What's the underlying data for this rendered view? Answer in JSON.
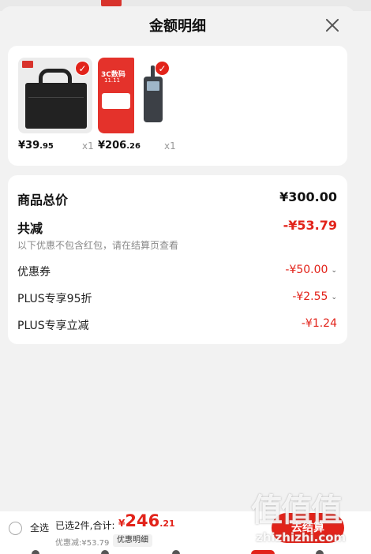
{
  "sheet": {
    "title": "金额明细"
  },
  "products": [
    {
      "price_int": "¥39",
      "price_dec": ".95",
      "qty": "x1",
      "thumb": "document-bag"
    },
    {
      "price_int": "¥206",
      "price_dec": ".26",
      "qty": "x1",
      "thumb": "walkie-talkie-promo",
      "poster_text_1": "3C数码",
      "poster_text_2": "11.11"
    }
  ],
  "summary": {
    "total_label": "商品总价",
    "total_value": "¥300.00",
    "reduce_label": "共减",
    "reduce_value": "-¥53.79",
    "note": "以下优惠不包含红包，请在结算页查看",
    "items": [
      {
        "label": "优惠券",
        "value": "-¥50.00",
        "has_caret": true
      },
      {
        "label": "PLUS专享95折",
        "value": "-¥2.55",
        "has_caret": true
      },
      {
        "label": "PLUS专享立减",
        "value": "-¥1.24",
        "has_caret": false
      }
    ]
  },
  "bottom_bar": {
    "select_all_label": "全选",
    "selected_text": "已选2件,合计:",
    "total_yen": "¥",
    "total_int": "246",
    "total_dec": ".21",
    "discount_text": "优惠减:¥53.79",
    "detail_label": "优惠明细",
    "checkout_label": "去结算"
  },
  "watermark": {
    "main": "值值值",
    "sub": "zhizhizhi.com"
  },
  "colors": {
    "accent": "#e2231a",
    "background": "#f2f2f2",
    "card": "#ffffff"
  }
}
